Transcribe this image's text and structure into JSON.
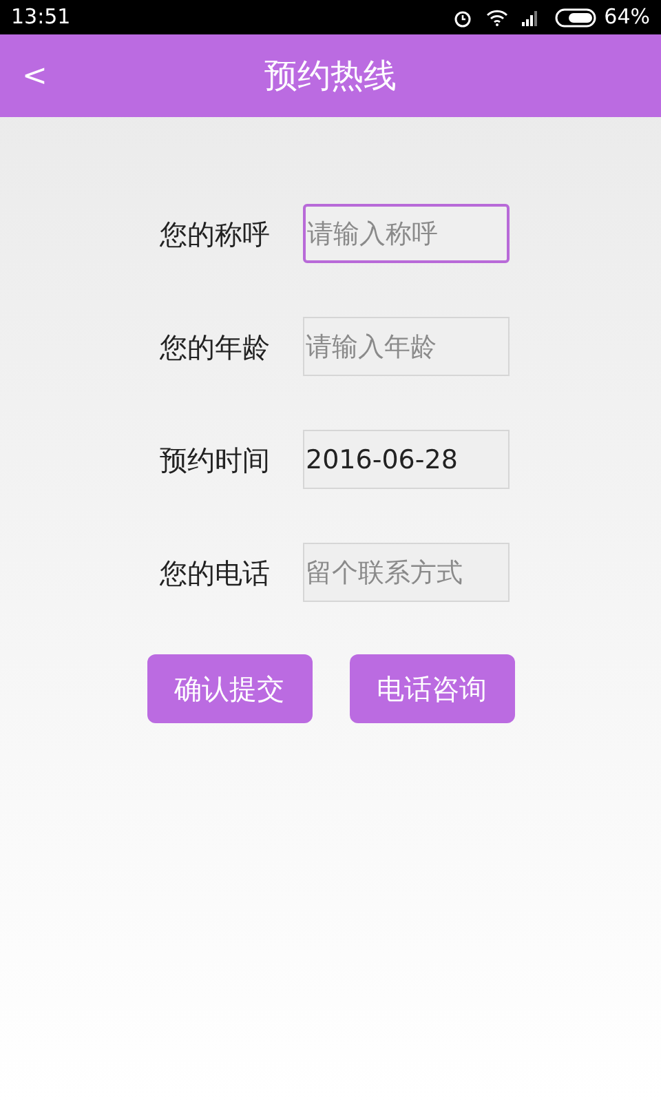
{
  "status_bar": {
    "time": "13:51",
    "battery_text": "64%"
  },
  "header": {
    "back": "<",
    "title": "预约热线"
  },
  "fields": [
    {
      "label": "您的称呼",
      "placeholder": "请输入称呼",
      "focused": true
    },
    {
      "label": "您的年龄",
      "placeholder": "请输入年龄",
      "focused": false
    },
    {
      "label": "预约时间",
      "value": "2016-06-28",
      "focused": false
    },
    {
      "label": "您的电话",
      "placeholder": "留个联系方式",
      "focused": false
    }
  ],
  "buttons": [
    "确认提交",
    "电话咨询"
  ]
}
